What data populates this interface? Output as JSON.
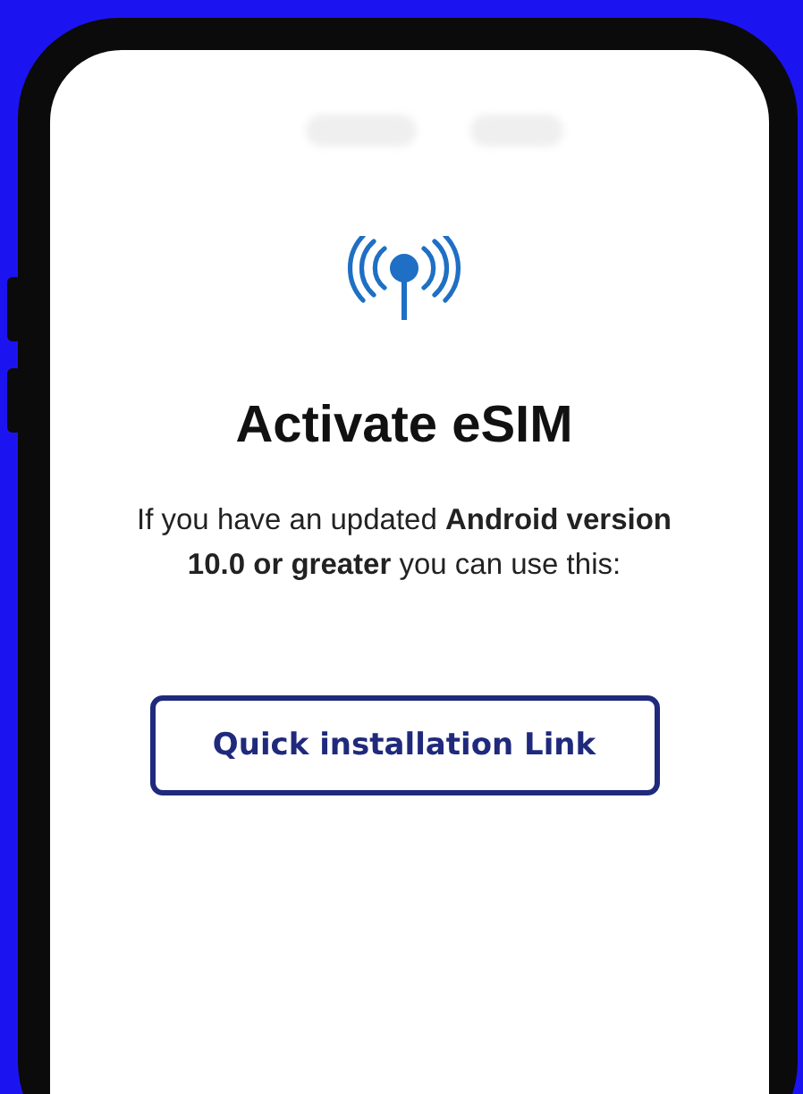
{
  "screen": {
    "title": "Activate eSIM",
    "description": "If you have an updated **Android version 10.0 or greater** you can use this:",
    "button": "Quick installation Link"
  }
}
